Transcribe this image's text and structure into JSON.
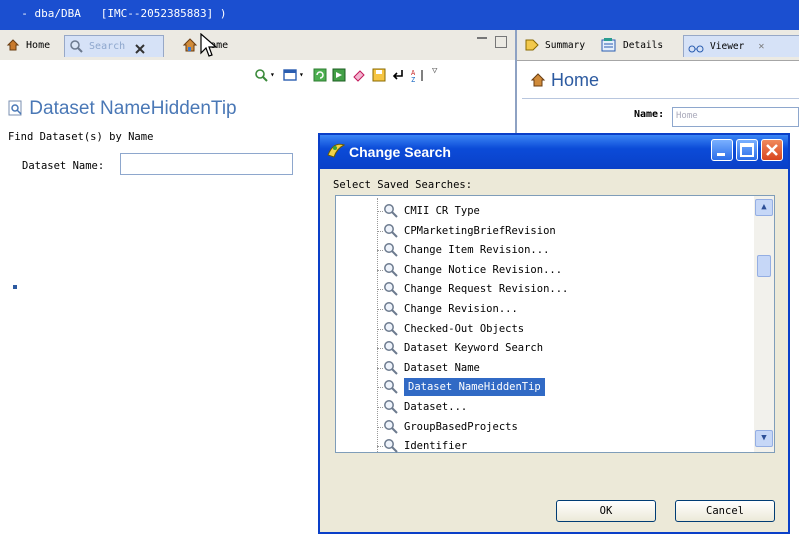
{
  "window": {
    "title": "  - dba/DBA   [IMC--2052385883] )"
  },
  "left_tabs": [
    {
      "label": "Home"
    },
    {
      "label": "Search"
    },
    {
      "label": "Home"
    }
  ],
  "dataset": {
    "title": "Dataset NameHiddenTip",
    "find_label": "Find Dataset(s) by Name",
    "name_label": "Dataset Name:",
    "name_value": ""
  },
  "right_tabs": [
    {
      "label": "Summary"
    },
    {
      "label": "Details"
    },
    {
      "label": "Viewer"
    }
  ],
  "home_panel": {
    "title": "Home",
    "name_label": "Name:",
    "name_placeholder": "Home"
  },
  "dialog": {
    "title": "Change Search",
    "select_label": "Select Saved Searches:",
    "items": [
      "CMII CR Type",
      "CPMarketingBriefRevision",
      "Change Item Revision...",
      "Change Notice Revision...",
      "Change Request Revision...",
      "Change Revision...",
      "Checked-Out Objects",
      "Dataset Keyword Search",
      "Dataset Name",
      "Dataset NameHiddenTip",
      "Dataset...",
      "GroupBasedProjects",
      "Identifier"
    ],
    "selected_item": "Dataset NameHiddenTip",
    "ok_label": "OK",
    "cancel_label": "Cancel"
  },
  "colors": {
    "titlebar": "#1b4fd0",
    "selection": "#316ac5",
    "heading": "#4a78b6",
    "close_button": "#d8451e"
  }
}
